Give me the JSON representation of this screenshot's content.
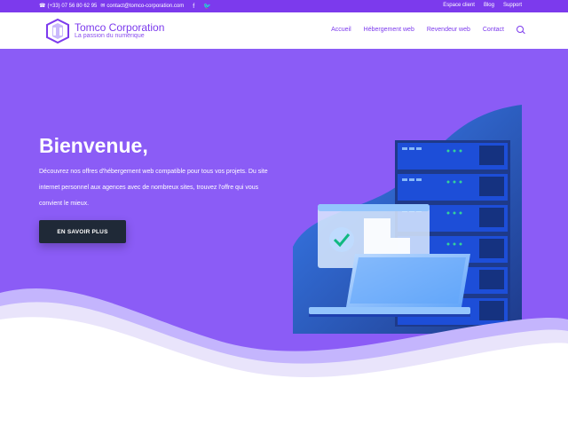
{
  "topbar": {
    "phone": "(+33) 07 56 80 62 95",
    "email": "contact@tomco-corporation.com",
    "links": [
      "Espace client",
      "Blog",
      "Support"
    ],
    "social": [
      "facebook-icon",
      "twitter-icon"
    ]
  },
  "header": {
    "brand": "Tomco Corporation",
    "tagline": "La passion du numérique",
    "nav": [
      "Accueil",
      "Hébergement web",
      "Revendeur web",
      "Contact"
    ]
  },
  "hero": {
    "title": "Bienvenue,",
    "description": "Découvrez nos offres d'hébergement web compatible pour tous vos projets. Du site internet personnel aux agences avec de nombreux sites, trouvez l'offre qui vous convient le mieux.",
    "cta": "EN SAVOIR PLUS"
  },
  "colors": {
    "accent": "#7c3aed",
    "hero_bg": "#8b5cf6",
    "button_bg": "#1f2937"
  }
}
